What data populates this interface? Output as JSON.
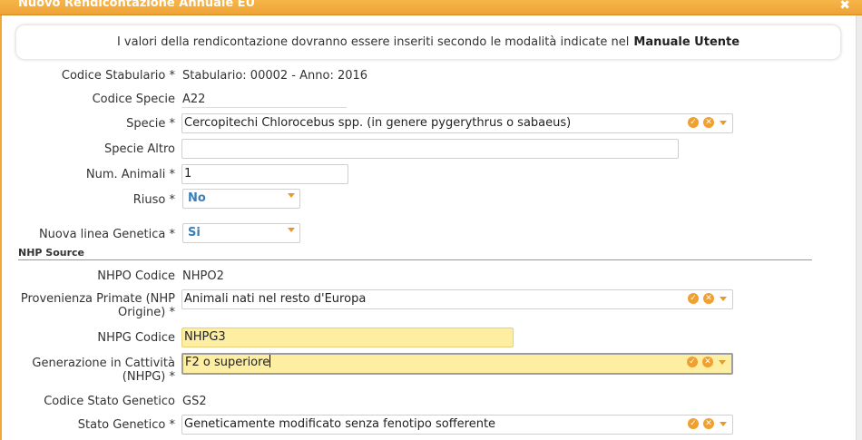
{
  "window": {
    "title": "Nuovo Rendicontazione Annuale EU",
    "close_symbol": "✖"
  },
  "info": {
    "text": "I valori della rendicontazione dovranno essere inseriti secondo le modalità indicate nel",
    "link": "Manuale Utente"
  },
  "fields": {
    "codice_stabulario": {
      "label": "Codice Stabulario *",
      "value": "Stabulario: 00002 - Anno: 2016"
    },
    "codice_specie": {
      "label": "Codice Specie",
      "value": "A22"
    },
    "specie": {
      "label": "Specie *",
      "value": "Cercopitechi Chlorocebus spp. (in genere pygerythrus o sabaeus)"
    },
    "specie_altro": {
      "label": "Specie Altro",
      "value": ""
    },
    "num_animali": {
      "label": "Num. Animali *",
      "value": "1"
    },
    "riuso": {
      "label": "Riuso *",
      "value": "No"
    },
    "nuova_linea": {
      "label": "Nuova linea Genetica *",
      "value": "Si"
    },
    "nhp_source_title": "NHP Source",
    "nhpo_codice": {
      "label": "NHPO Codice",
      "value": "NHPO2"
    },
    "provenienza": {
      "label": "Provenienza Primate (NHP Origine) *",
      "value": "Animali nati nel resto d'Europa"
    },
    "nhpg_codice": {
      "label": "NHPG Codice",
      "value": "NHPG3"
    },
    "generazione": {
      "label": "Generazione in Cattività (NHPG) *",
      "value": "F2 o superiore"
    },
    "codice_stato": {
      "label": "Codice Stato Genetico",
      "value": "GS2"
    },
    "stato_genetico": {
      "label": "Stato Genetico *",
      "value": "Geneticamente modificato senza fenotipo sofferente"
    }
  },
  "icons": {
    "confirm": "check-icon",
    "clear": "clear-icon",
    "dropdown": "chevron-down-icon"
  },
  "colors": {
    "accent": "#f0a030",
    "highlight": "#fdeea2",
    "select_text": "#3a7fb8"
  }
}
